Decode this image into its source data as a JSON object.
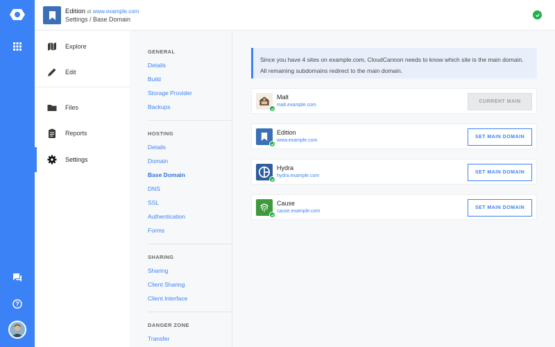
{
  "header": {
    "site_name": "Edition",
    "at": "at",
    "site_url": "www.example.com",
    "breadcrumb": "Settings / Base Domain"
  },
  "rail": {
    "icons": [
      "cloudcannon-logo-icon",
      "apps-grid-icon",
      "chat-icon",
      "help-icon",
      "avatar"
    ]
  },
  "main_nav": {
    "items": [
      {
        "label": "Explore",
        "icon": "map-icon"
      },
      {
        "label": "Edit",
        "icon": "pencil-icon"
      },
      {
        "label": "Files",
        "icon": "folder-icon"
      },
      {
        "label": "Reports",
        "icon": "clipboard-icon"
      },
      {
        "label": "Settings",
        "icon": "gear-icon",
        "active": true
      }
    ]
  },
  "settings_nav": {
    "sections": [
      {
        "heading": "GENERAL",
        "items": [
          "Details",
          "Build",
          "Storage Provider",
          "Backups"
        ]
      },
      {
        "heading": "HOSTING",
        "items": [
          "Details",
          "Domain",
          "Base Domain",
          "DNS",
          "SSL",
          "Authentication",
          "Forms"
        ]
      },
      {
        "heading": "SHARING",
        "items": [
          "Sharing",
          "Client Sharing",
          "Client Interface"
        ]
      },
      {
        "heading": "DANGER ZONE",
        "items": [
          "Transfer"
        ]
      }
    ],
    "active": "Base Domain"
  },
  "content": {
    "info": "Since you have 4 sites on example.com, CloudCannon needs to know which site is the main domain. All remaining subdomains redirect to the main domain.",
    "sites": [
      {
        "name": "Malt",
        "url": "malt.example.com",
        "button": "CURRENT MAIN",
        "disabled": true
      },
      {
        "name": "Edition",
        "url": "www.example.com",
        "button": "SET MAIN DOMAIN",
        "disabled": false
      },
      {
        "name": "Hydra",
        "url": "hydra.example.com",
        "button": "SET MAIN DOMAIN",
        "disabled": false
      },
      {
        "name": "Cause",
        "url": "cause.example.com",
        "button": "SET MAIN DOMAIN",
        "disabled": false
      }
    ]
  },
  "colors": {
    "accent": "#3b82f6",
    "success": "#22b04b",
    "info_bg": "#e9effa"
  }
}
